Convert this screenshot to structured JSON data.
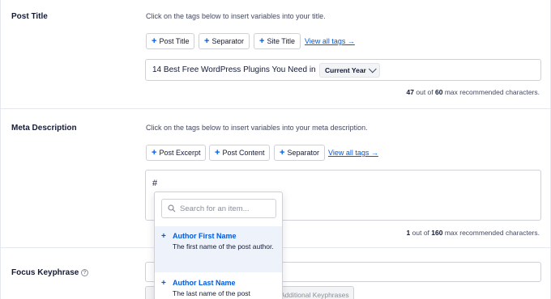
{
  "post_title": {
    "label": "Post Title",
    "hint": "Click on the tags below to insert variables into your title.",
    "tags": [
      "Post Title",
      "Separator",
      "Site Title"
    ],
    "view_all": "View all tags →",
    "value": "14 Best Free WordPress Plugins You Need in",
    "year_option": "Current Year",
    "counter": {
      "count": "47",
      "text1": " out of ",
      "max": "60",
      "text2": " max recommended characters."
    }
  },
  "meta_description": {
    "label": "Meta Description",
    "hint": "Click on the tags below to insert variables into your meta description.",
    "tags": [
      "Post Excerpt",
      "Post Content",
      "Separator"
    ],
    "view_all": "View all tags →",
    "value": "#",
    "counter": {
      "count": "1",
      "text1": " out of ",
      "max": "160",
      "text2": " max recommended characters."
    }
  },
  "dropdown": {
    "search_placeholder": "Search for an item...",
    "items": [
      {
        "name": "Author First Name",
        "desc": "The first name of the post author."
      },
      {
        "name": "Author Last Name",
        "desc": "The last name of the post"
      }
    ]
  },
  "focus_keyphrase": {
    "label": "Focus Keyphrase",
    "help_glyph": "?",
    "additional_button": "Additional Keyphrases"
  },
  "colors": {
    "accent": "#005ae0",
    "text": "#141b38",
    "muted": "#434960",
    "border": "#d0d1d7",
    "highlight": "#edf2fb"
  },
  "icons": {
    "tag_plus": "plus-icon",
    "search": "search-icon",
    "help": "help-circle-icon",
    "select_chevron": "chevron-down-icon"
  }
}
